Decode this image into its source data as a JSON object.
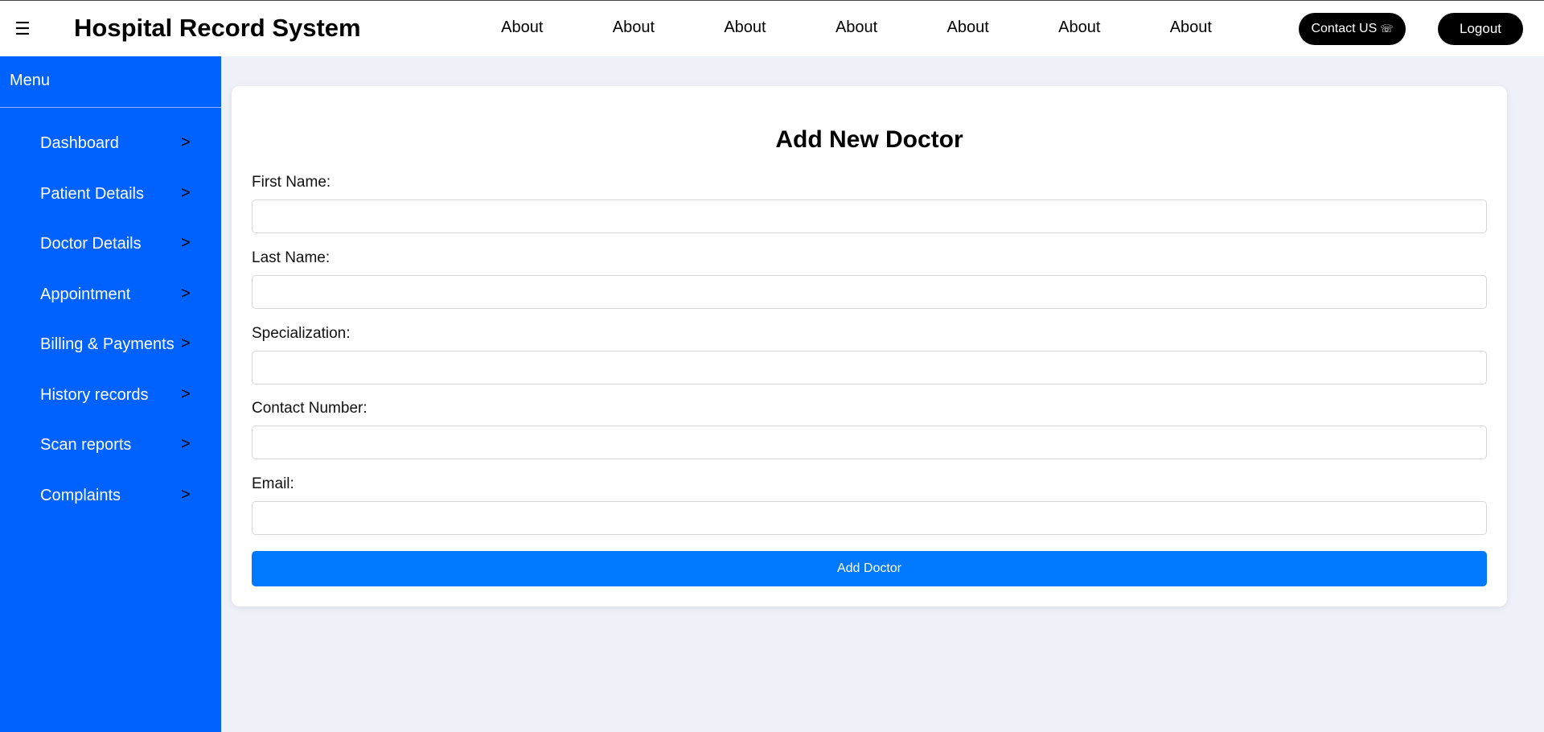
{
  "header": {
    "menu_icon": "☰",
    "title": "Hospital Record System",
    "nav": [
      "About",
      "About",
      "About",
      "About",
      "About",
      "About",
      "About"
    ],
    "contact_label": "Contact US",
    "contact_icon": "☏",
    "logout_label": "Logout"
  },
  "sidebar": {
    "title": "Menu",
    "items": [
      {
        "label": "Dashboard",
        "arrow": ">"
      },
      {
        "label": "Patient Details",
        "arrow": ">"
      },
      {
        "label": "Doctor Details",
        "arrow": ">"
      },
      {
        "label": "Appointment",
        "arrow": ">"
      },
      {
        "label": "Billing & Payments",
        "arrow": ">"
      },
      {
        "label": "History records",
        "arrow": ">"
      },
      {
        "label": "Scan reports",
        "arrow": ">"
      },
      {
        "label": "Complaints",
        "arrow": ">"
      }
    ]
  },
  "form": {
    "title": "Add New Doctor",
    "fields": [
      {
        "label": "First Name:",
        "value": ""
      },
      {
        "label": "Last Name:",
        "value": ""
      },
      {
        "label": "Specialization:",
        "value": ""
      },
      {
        "label": "Contact Number:",
        "value": ""
      },
      {
        "label": "Email:",
        "value": ""
      }
    ],
    "submit_label": "Add Doctor"
  },
  "colors": {
    "sidebar_bg": "#0062fe",
    "button_bg": "#0079fe",
    "page_bg": "#eef1f8"
  }
}
